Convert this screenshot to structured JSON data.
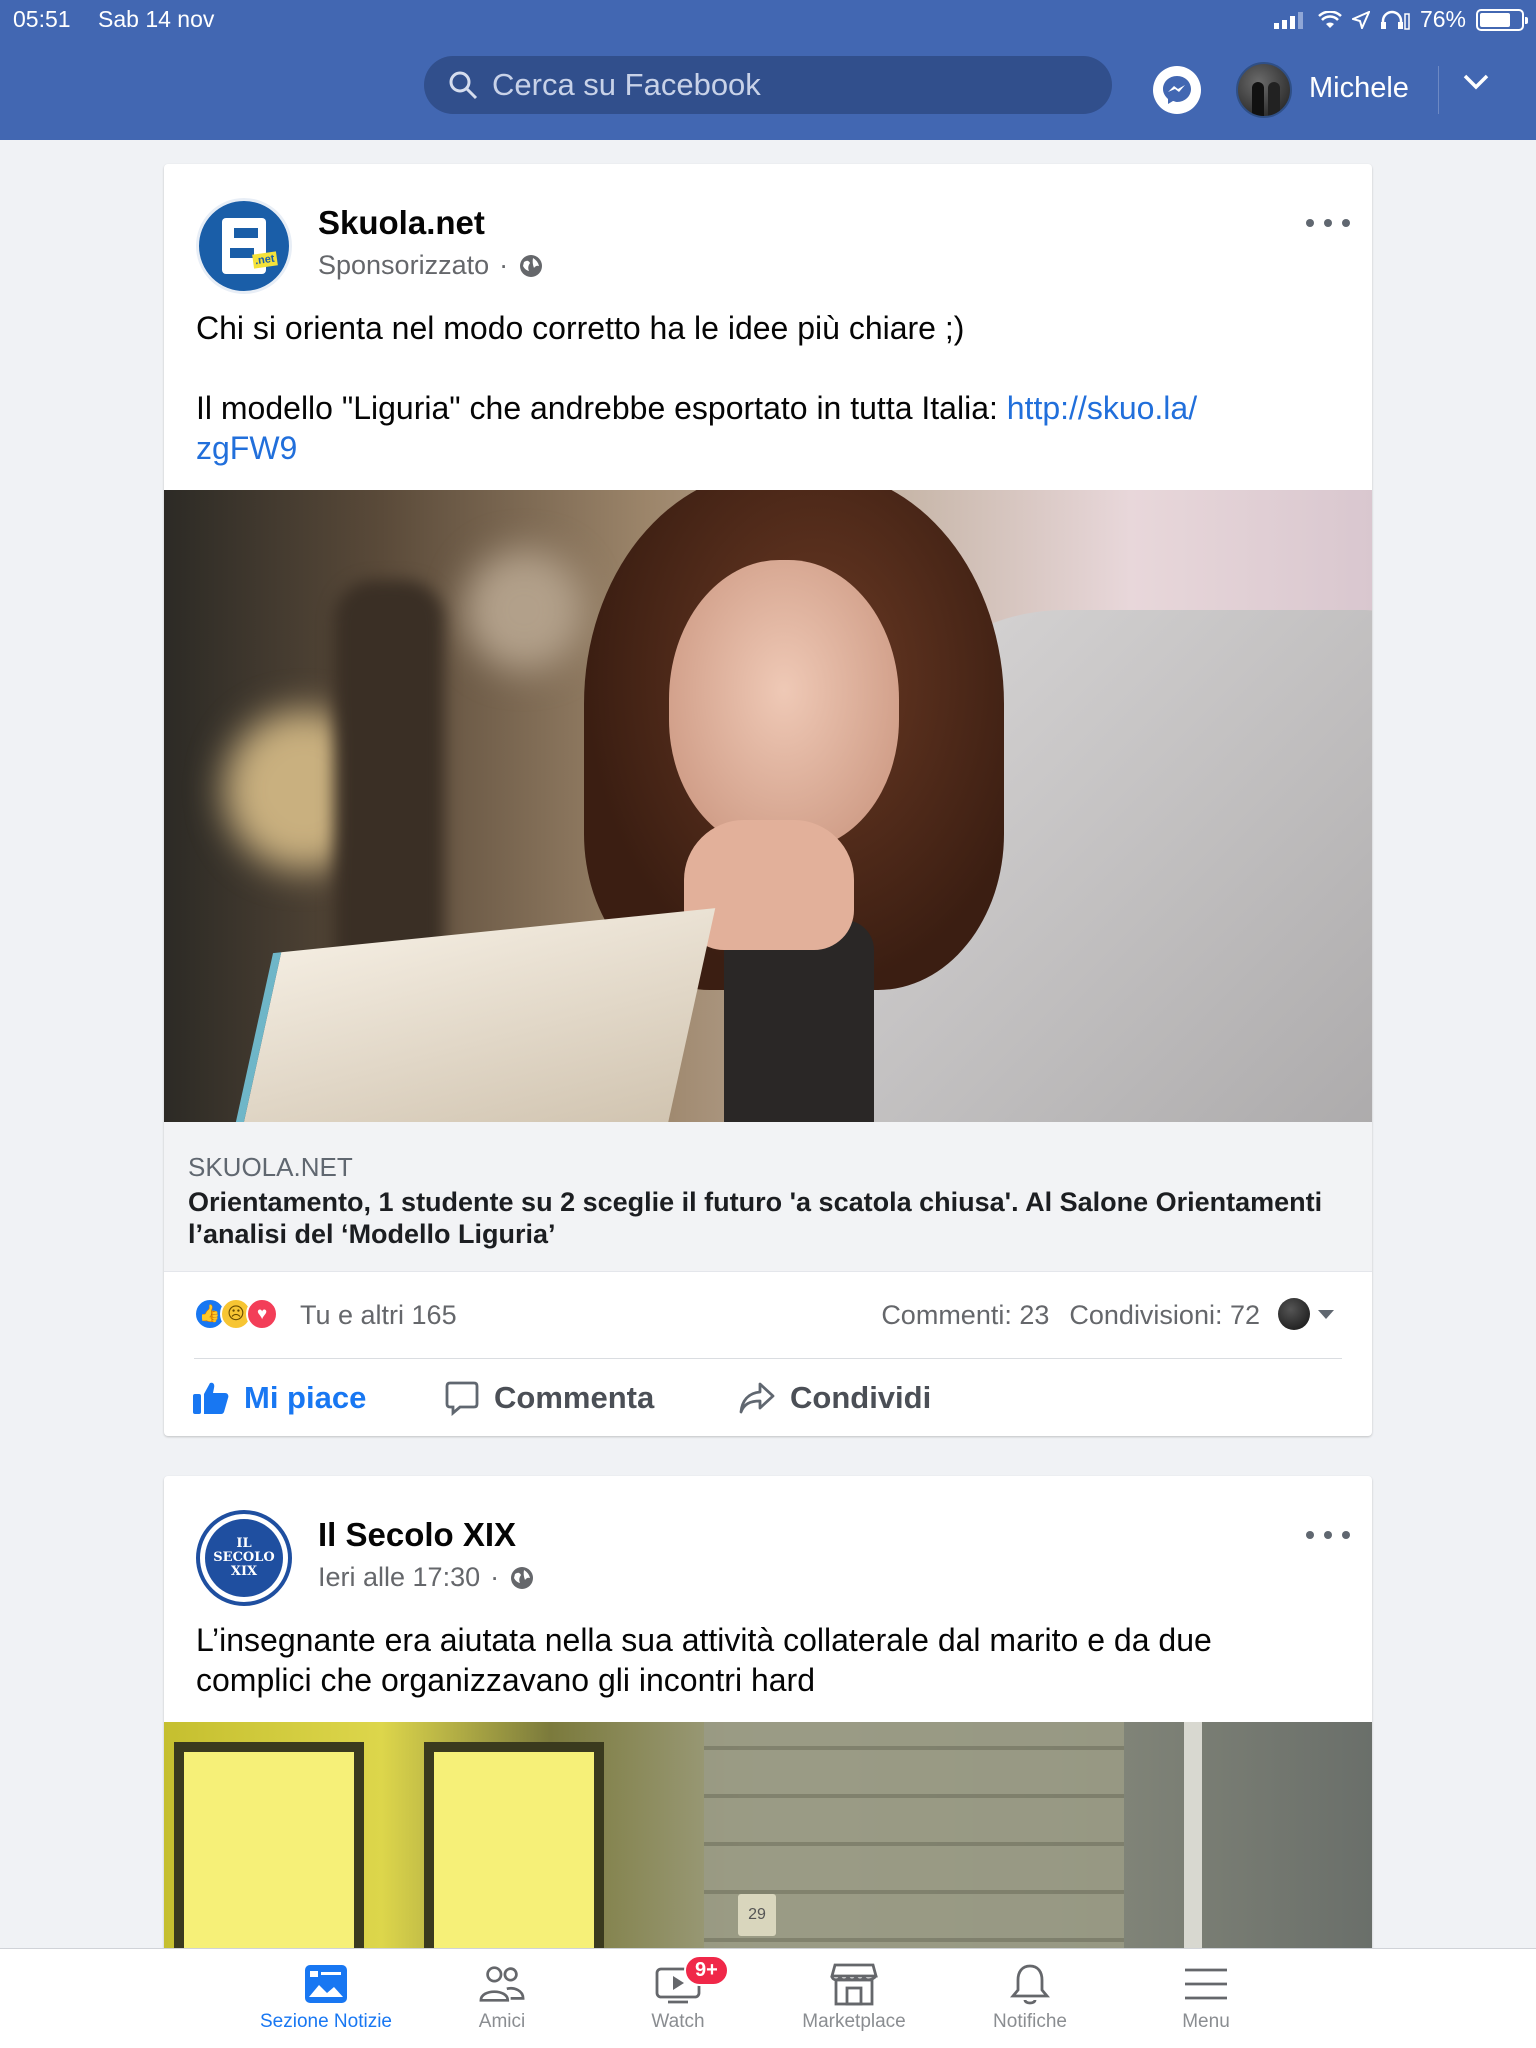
{
  "status_bar": {
    "time": "05:51",
    "date": "Sab 14 nov",
    "battery": "76%",
    "battery_level": 0.76
  },
  "header": {
    "search_placeholder": "Cerca su Facebook",
    "user_name": "Michele"
  },
  "posts": [
    {
      "page_name": "Skuola.net",
      "meta": "Sponsorizzato",
      "text_line1": "Chi si orienta nel modo corretto ha le idee più chiare ;)",
      "text_line2": "Il modello \"Liguria\" che andrebbe esportato in tutta Italia: ",
      "link_url": "http://skuo.la/\nzgFW9",
      "link_domain": "SKUOLA.NET",
      "link_title": "Orientamento, 1 studente su 2 sceglie il futuro 'a scatola chiusa'. Al Salone Orientamenti l’analisi del ‘Modello Liguria’",
      "reactions_text": "Tu e altri 165",
      "comments": "Commenti: 23",
      "shares": "Condivisioni: 72",
      "actions": {
        "like": "Mi piace",
        "comment": "Commenta",
        "share": "Condividi"
      }
    },
    {
      "page_name": "Il Secolo XIX",
      "logo_text": "IL SECOLO XIX",
      "meta": "Ieri alle 17:30",
      "text": "L’insegnante era aiutata nella sua attività collaterale dal marito e da due complici che organizzavano gli incontri hard",
      "photo_plate": "29"
    }
  ],
  "tabbar": {
    "tabs": [
      {
        "label": "Sezione Notizie",
        "icon": "news-feed-icon",
        "active": true
      },
      {
        "label": "Amici",
        "icon": "friends-icon",
        "active": false
      },
      {
        "label": "Watch",
        "icon": "watch-icon",
        "active": false,
        "badge": "9+"
      },
      {
        "label": "Marketplace",
        "icon": "marketplace-icon",
        "active": false
      },
      {
        "label": "Notifiche",
        "icon": "bell-icon",
        "active": false
      },
      {
        "label": "Menu",
        "icon": "menu-icon",
        "active": false
      }
    ]
  },
  "colors": {
    "brand": "#4267b2",
    "link": "#216fdb",
    "like_active": "#1877f2",
    "badge": "#f02849"
  }
}
